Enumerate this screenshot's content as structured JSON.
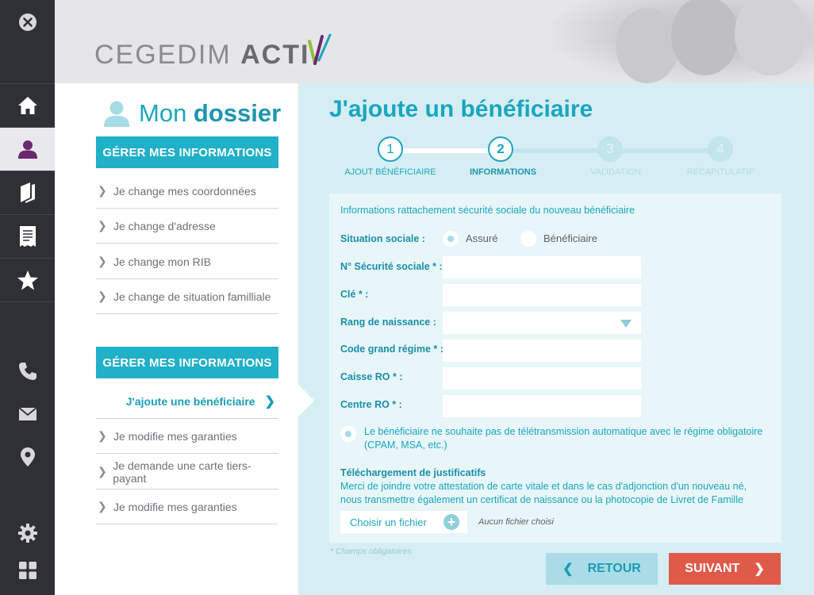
{
  "header": {
    "logo_light": "CEGEDIM ",
    "logo_bold": "ACTI"
  },
  "rail": {
    "items": [
      {
        "icon": "close-icon"
      },
      {
        "icon": "home-icon"
      },
      {
        "icon": "user-icon",
        "active": true
      },
      {
        "icon": "book-icon"
      },
      {
        "icon": "receipt-icon"
      },
      {
        "icon": "star-icon"
      },
      {
        "icon": "phone-icon"
      },
      {
        "icon": "mail-icon"
      },
      {
        "icon": "location-pin-icon"
      },
      {
        "icon": "gear-icon"
      },
      {
        "icon": "grid-icon"
      }
    ]
  },
  "side": {
    "title_light": "Mon ",
    "title_bold": "dossier",
    "section1": {
      "label": "GÉRER MES INFORMATIONS",
      "items": [
        "Je change mes coordonnées",
        "Je change d'adresse",
        "Je change mon RIB",
        "Je change de situation familliale"
      ]
    },
    "section2": {
      "label": "GÉRER MES INFORMATIONS",
      "current": "J'ajoute une bénéficiaire",
      "items": [
        "Je modifie mes garanties",
        "Je demande une carte tiers-payant",
        "Je modifie mes garanties"
      ]
    }
  },
  "main": {
    "title": "J'ajoute un bénéficiaire",
    "steps": [
      {
        "num": "1",
        "label": "AJOUT BÉNÉFICIAIRE",
        "state": "done"
      },
      {
        "num": "2",
        "label": "INFORMATIONS",
        "state": "current"
      },
      {
        "num": "3",
        "label": "VALIDATION",
        "state": "todo"
      },
      {
        "num": "4",
        "label": "RÉCAPITULATIF",
        "state": "todo"
      }
    ],
    "form": {
      "intro": "Informations rattachement sécurité sociale du nouveau bénéficiaire",
      "situation_label": "Situation sociale :",
      "situation_options": [
        "Assuré",
        "Bénéficiaire"
      ],
      "situation_selected": "Assuré",
      "fields": [
        {
          "label": "N° Sécurité sociale * :",
          "value": ""
        },
        {
          "label": "Clé * :",
          "value": ""
        },
        {
          "label": "Rang de naissance :",
          "value": "",
          "type": "select"
        },
        {
          "label": "Code grand régime * :",
          "value": ""
        },
        {
          "label": "Caisse RO * :",
          "value": ""
        },
        {
          "label": "Centre RO * :",
          "value": ""
        }
      ],
      "teletransmission_note": "Le bénéficiaire ne souhaite pas de télétransmission automatique avec le régime obligatoire (CPAM, MSA, etc.)",
      "upload_title": "Téléchargement de justificatifs",
      "upload_text": "Merci de joindre votre attestation de carte vitale et dans le cas d'adjonction d'un nouveau né, nous transmettre également un certificat de naissance ou la photocopie de Livret de Famille",
      "file_button": "Choisir un fichier",
      "no_file": "Aucun fichier choisi"
    },
    "required_note": "* Champs obligatoires",
    "back_label": "RETOUR",
    "next_label": "SUIVANT"
  },
  "colors": {
    "accent": "#1aa6bf",
    "next_button": "#e05a49",
    "rail": "#2f3035",
    "active_user": "#6b2770"
  }
}
